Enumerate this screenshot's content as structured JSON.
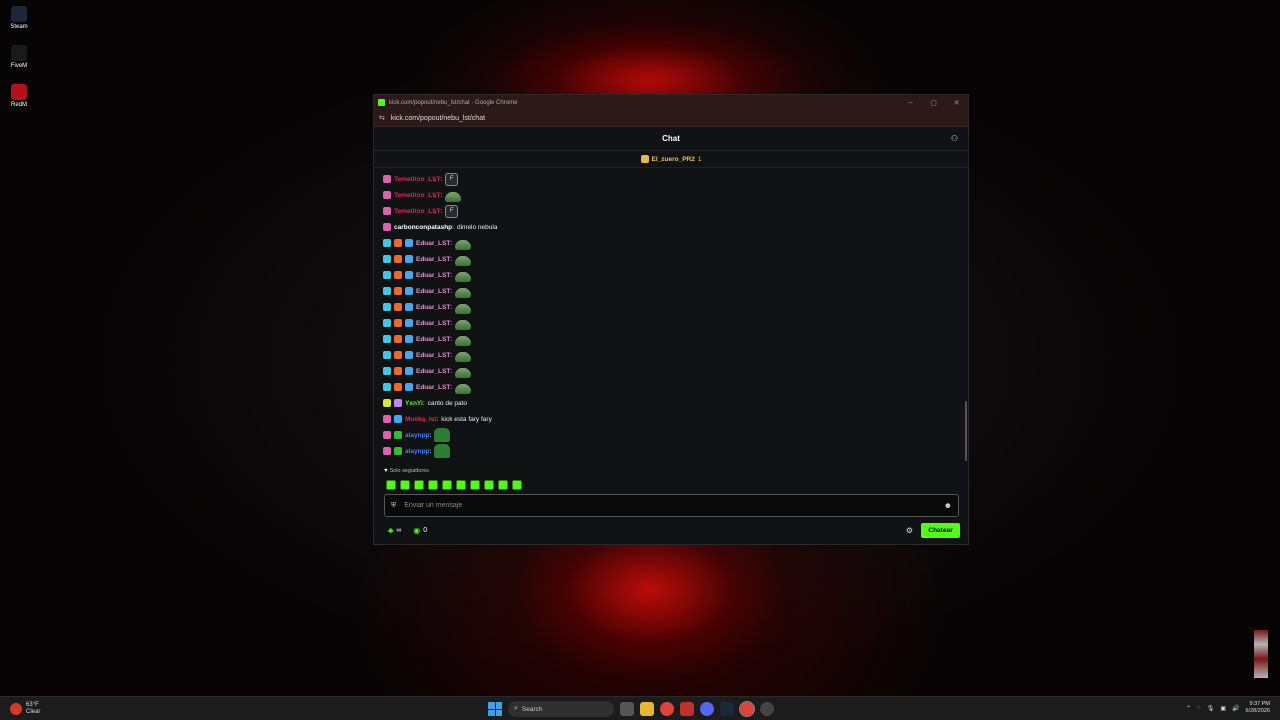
{
  "desktop": {
    "icons": [
      {
        "label": "Steam",
        "color": "#1b2838"
      },
      {
        "label": "FiveM",
        "color": "#1a1a1a"
      },
      {
        "label": "RedM",
        "color": "#b3121a"
      }
    ]
  },
  "browser": {
    "window_title": "kick.com/popout/nebu_lst/chat - Google Chrome",
    "url": "kick.com/popout/nebu_lst/chat",
    "controls": {
      "minimize": "–",
      "maximize": "▢",
      "close": "✕"
    }
  },
  "chat": {
    "header_title": "Chat",
    "pinned": {
      "user": "El_zuero_PR2",
      "count": "1"
    },
    "messages": [
      {
        "user": "Temetitoo_LST",
        "color": "#e0245e",
        "badges": [
          "sub"
        ],
        "text": "",
        "emote": "f"
      },
      {
        "user": "Temetitoo_LST",
        "color": "#e0245e",
        "badges": [
          "sub"
        ],
        "text": "",
        "emote": "frog"
      },
      {
        "user": "Temetitoo_LST",
        "color": "#e0245e",
        "badges": [
          "sub"
        ],
        "text": "",
        "emote": "f"
      },
      {
        "user": "carbonconpatashp",
        "color": "#ffffff",
        "badges": [
          "sub"
        ],
        "text": "dimelo nebula",
        "emote": ""
      },
      {
        "user": "Eduar_LST",
        "color": "#f08cd0",
        "badges": [
          "mod",
          "fox",
          "vip"
        ],
        "text": "",
        "emote": "frog"
      },
      {
        "user": "Eduar_LST",
        "color": "#f08cd0",
        "badges": [
          "mod",
          "fox",
          "vip"
        ],
        "text": "",
        "emote": "frog"
      },
      {
        "user": "Eduar_LST",
        "color": "#f08cd0",
        "badges": [
          "mod",
          "fox",
          "vip"
        ],
        "text": "",
        "emote": "frog"
      },
      {
        "user": "Eduar_LST",
        "color": "#f08cd0",
        "badges": [
          "mod",
          "fox",
          "vip"
        ],
        "text": "",
        "emote": "frog"
      },
      {
        "user": "Eduar_LST",
        "color": "#f08cd0",
        "badges": [
          "mod",
          "fox",
          "vip"
        ],
        "text": "",
        "emote": "frog"
      },
      {
        "user": "Eduar_LST",
        "color": "#f08cd0",
        "badges": [
          "mod",
          "fox",
          "vip"
        ],
        "text": "",
        "emote": "frog"
      },
      {
        "user": "Eduar_LST",
        "color": "#f08cd0",
        "badges": [
          "mod",
          "fox",
          "vip"
        ],
        "text": "",
        "emote": "frog"
      },
      {
        "user": "Eduar_LST",
        "color": "#f08cd0",
        "badges": [
          "mod",
          "fox",
          "vip"
        ],
        "text": "",
        "emote": "frog"
      },
      {
        "user": "Eduar_LST",
        "color": "#f08cd0",
        "badges": [
          "mod",
          "fox",
          "vip"
        ],
        "text": "",
        "emote": "frog"
      },
      {
        "user": "Eduar_LST",
        "color": "#f08cd0",
        "badges": [
          "mod",
          "fox",
          "vip"
        ],
        "text": "",
        "emote": "frog"
      },
      {
        "user": "YxnYi",
        "color": "#53fc18",
        "badges": [
          "og",
          "gift"
        ],
        "text": "canto de pato",
        "emote": ""
      },
      {
        "user": "Mueka_lst",
        "color": "#e0245e",
        "badges": [
          "sub",
          "vip"
        ],
        "text": "kick esta fary fary",
        "emote": ""
      },
      {
        "user": "alaynpp",
        "color": "#3f7fff",
        "badges": [
          "sub",
          "green"
        ],
        "text": "",
        "emote": "pepe"
      },
      {
        "user": "alaynpp",
        "color": "#3f7fff",
        "badges": [
          "sub",
          "green"
        ],
        "text": "",
        "emote": "pepe"
      }
    ],
    "followers_only": "Solo seguidores",
    "quick_emote_count": 10,
    "input_placeholder": "Enviar un mensaje",
    "bottom": {
      "points_value": "∞",
      "kicks_value": "0",
      "send_label": "Chatear"
    },
    "accent": "#53fc18"
  },
  "taskbar": {
    "weather_temp": "63°F",
    "weather_desc": "Clear",
    "search_label": "Search",
    "time": "9:37 PM",
    "date": "6/28/2026"
  }
}
